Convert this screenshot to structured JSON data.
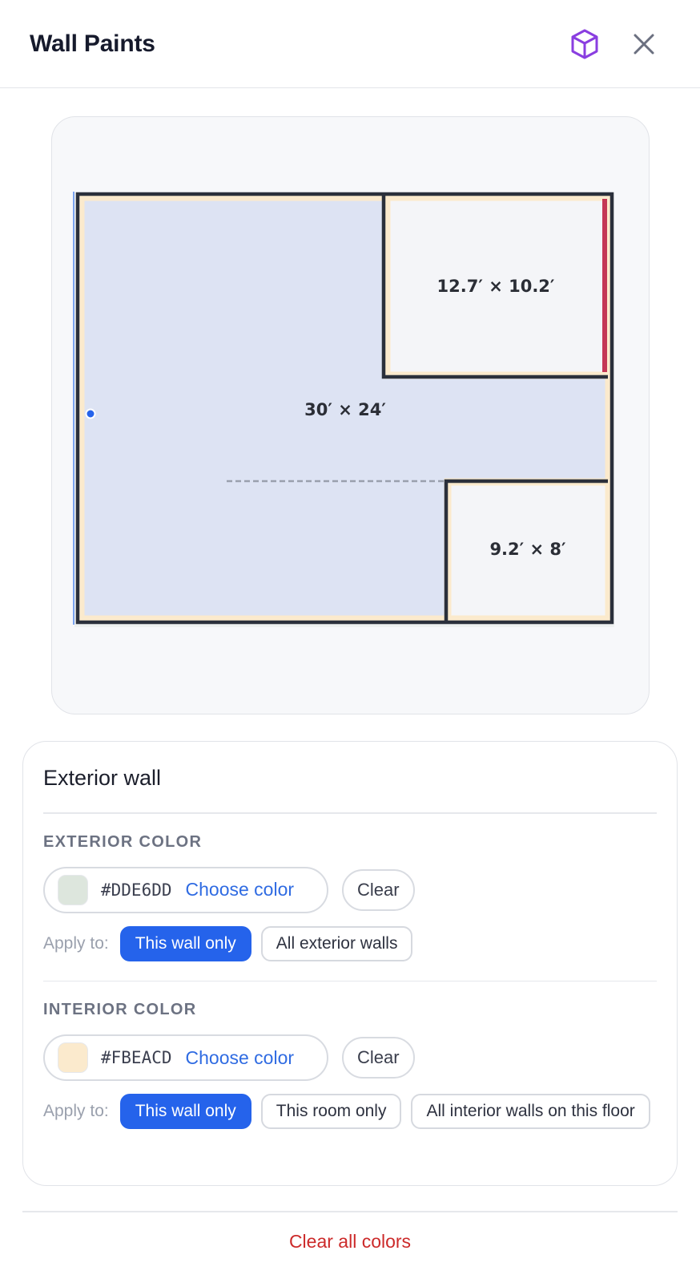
{
  "header": {
    "title": "Wall Paints"
  },
  "icons": {
    "view3d": "cube-icon",
    "close": "close-icon"
  },
  "floorplan": {
    "rooms": [
      {
        "label": "30′ × 24′"
      },
      {
        "label": "12.7′ × 10.2′"
      },
      {
        "label": "9.2′ × 8′"
      }
    ]
  },
  "selection": {
    "title": "Exterior wall"
  },
  "exterior": {
    "label": "EXTERIOR COLOR",
    "hex": "#DDE6DD",
    "choose_label": "Choose color",
    "clear_label": "Clear",
    "apply_label": "Apply to:",
    "options": [
      "This wall only",
      "All exterior walls"
    ],
    "selected": "This wall only"
  },
  "interior": {
    "label": "INTERIOR COLOR",
    "hex": "#FBEACD",
    "choose_label": "Choose color",
    "clear_label": "Clear",
    "apply_label": "Apply to:",
    "options": [
      "This wall only",
      "This room only",
      "All interior walls on this floor"
    ],
    "selected": "This wall only"
  },
  "footer": {
    "clear_all_label": "Clear all colors"
  },
  "colors": {
    "accent": "#2563eb",
    "danger": "#cc2a2a",
    "room_fill": "#dde3f3",
    "wall_dark": "#2b303b",
    "selected_wall": "#c43755",
    "cube_icon": "#8a3ee0"
  }
}
